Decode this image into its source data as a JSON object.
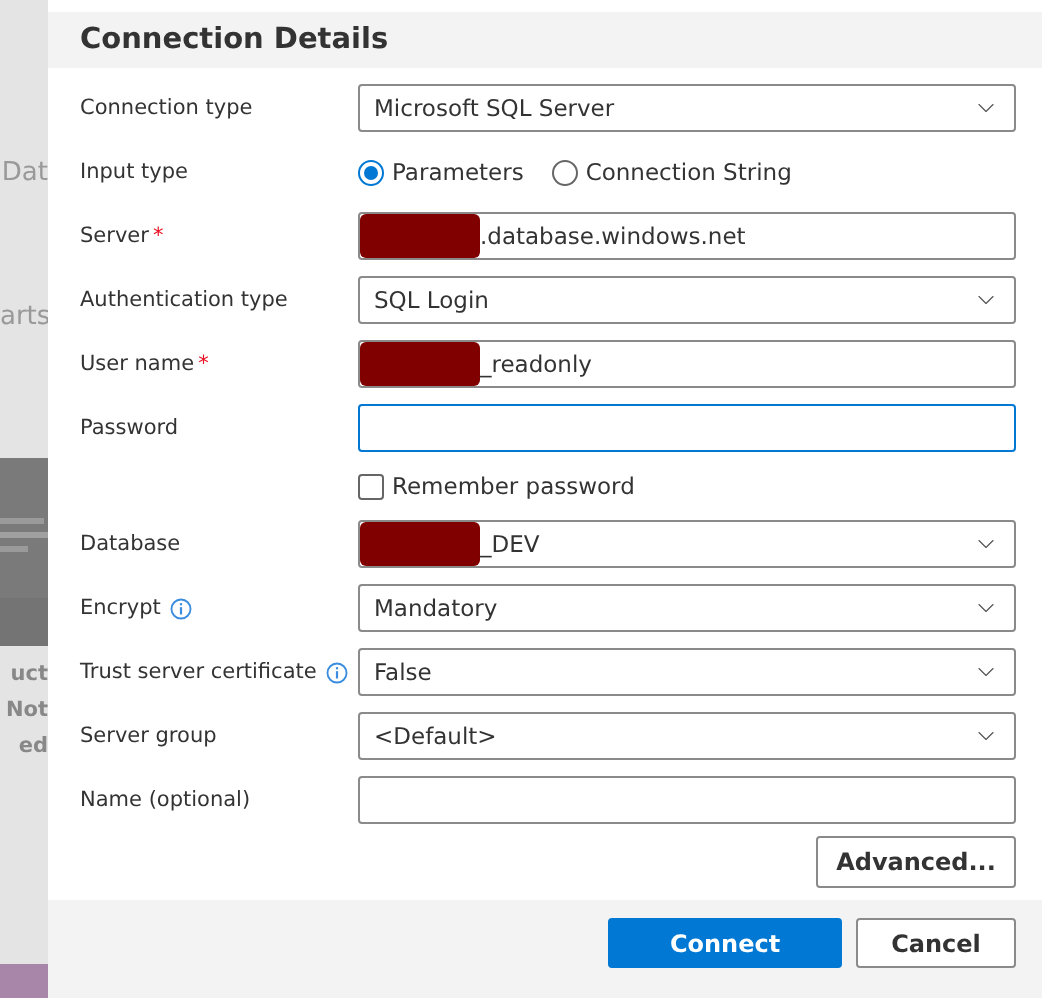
{
  "background": {
    "upper_texts": [
      "Dat",
      "arts"
    ],
    "thumbnail": {
      "kind": "picture"
    },
    "lower_texts": [
      "uct",
      "Not",
      "ed"
    ]
  },
  "dialog": {
    "title": "Connection Details",
    "fields": [
      {
        "kind": "select",
        "label": "Connection type",
        "value": "Microsoft SQL Server"
      },
      {
        "kind": "radio",
        "label": "Input type",
        "options": [
          {
            "label": "Parameters",
            "selected": true
          },
          {
            "label": "Connection String",
            "selected": false
          }
        ]
      },
      {
        "kind": "text",
        "label": "Server",
        "required_mark": "*",
        "value": ".database.windows.net",
        "redacted": true
      },
      {
        "kind": "select",
        "label": "Authentication type",
        "value": "SQL Login"
      },
      {
        "kind": "text",
        "label": "User name",
        "required_mark": "*",
        "value": "_readonly",
        "redacted": true
      },
      {
        "kind": "text",
        "label": "Password",
        "focused": true
      },
      {
        "kind": "checkbox",
        "label": "Remember password",
        "checked": false
      },
      {
        "kind": "select",
        "label": "Database",
        "value": "_DEV",
        "redacted": true
      },
      {
        "kind": "select",
        "label": "Encrypt",
        "info": true,
        "value": "Mandatory"
      },
      {
        "kind": "select",
        "label": "Trust server certificate",
        "info": true,
        "value": "False"
      },
      {
        "kind": "select",
        "label": "Server group",
        "value": "<Default>"
      },
      {
        "kind": "text",
        "label": "Name (optional)"
      }
    ],
    "advanced_button": "Advanced...",
    "buttons": [
      {
        "label": "Connect",
        "primary": true
      },
      {
        "label": "Cancel",
        "primary": false
      }
    ]
  }
}
